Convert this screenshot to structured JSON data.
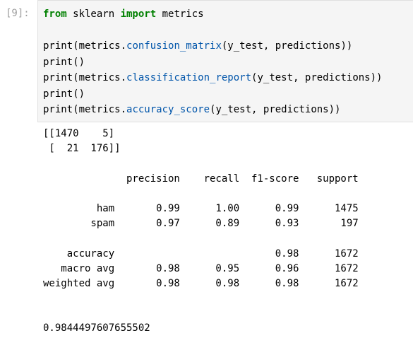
{
  "cell": {
    "prompt": "[9]:",
    "code": [
      {
        "parts": [
          {
            "text": "from",
            "style": "kw"
          },
          {
            "text": " sklearn ",
            "style": ""
          },
          {
            "text": "import",
            "style": "kw"
          },
          {
            "text": " metrics",
            "style": ""
          }
        ]
      },
      {
        "parts": [
          {
            "text": "",
            "style": ""
          }
        ]
      },
      {
        "parts": [
          {
            "text": "print(metrics.",
            "style": ""
          },
          {
            "text": "confusion_matrix",
            "style": "fn"
          },
          {
            "text": "(y_test, predictions))",
            "style": ""
          }
        ]
      },
      {
        "parts": [
          {
            "text": "print()",
            "style": ""
          }
        ]
      },
      {
        "parts": [
          {
            "text": "print(metrics.",
            "style": ""
          },
          {
            "text": "classification_report",
            "style": "fn"
          },
          {
            "text": "(y_test, predictions))",
            "style": ""
          }
        ]
      },
      {
        "parts": [
          {
            "text": "print()",
            "style": ""
          }
        ]
      },
      {
        "parts": [
          {
            "text": "print(metrics.",
            "style": ""
          },
          {
            "text": "accuracy_score",
            "style": "fn"
          },
          {
            "text": "(y_test, predictions))",
            "style": ""
          }
        ]
      }
    ],
    "output": [
      "[[1470    5]",
      " [  21  176]]",
      "",
      "              precision    recall  f1-score   support",
      "",
      "         ham       0.99      1.00      0.99      1475",
      "        spam       0.97      0.89      0.93       197",
      "",
      "    accuracy                           0.98      1672",
      "   macro avg       0.98      0.95      0.96      1672",
      "weighted avg       0.98      0.98      0.98      1672",
      "",
      "",
      "0.9844497607655502"
    ]
  },
  "colors": {
    "keyword": "#008000",
    "function": "#0055aa",
    "prompt": "#9e9e9e",
    "input_background": "#f5f5f5"
  }
}
